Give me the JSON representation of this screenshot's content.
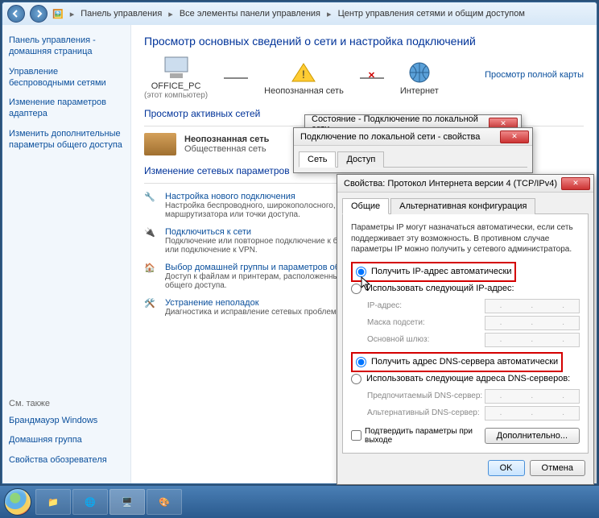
{
  "breadcrumb": [
    "Панель управления",
    "Все элементы панели управления",
    "Центр управления сетями и общим доступом"
  ],
  "sidebar": {
    "items": [
      "Панель управления - домашняя страница",
      "Управление беспроводными сетями",
      "Изменение параметров адаптера",
      "Изменить дополнительные параметры общего доступа"
    ],
    "also_label": "См. также",
    "also": [
      "Брандмауэр Windows",
      "Домашняя группа",
      "Свойства обозревателя"
    ]
  },
  "page": {
    "title": "Просмотр основных сведений о сети и настройка подключений",
    "map_link": "Просмотр полной карты",
    "nodes": {
      "pc": "OFFICE_PC",
      "pc_sub": "(этот компьютер)",
      "unknown": "Неопознанная сеть",
      "internet": "Интернет"
    },
    "active_head": "Просмотр активных сетей",
    "active_name": "Неопознанная сеть",
    "active_type": "Общественная сеть",
    "change_head": "Изменение сетевых параметров",
    "tasks": [
      {
        "link": "Настройка нового подключения",
        "desc": "Настройка беспроводного, широкополосного, модемного, прямого или VPN-подключения или же настройка маршрутизатора или точки доступа."
      },
      {
        "link": "Подключиться к сети",
        "desc": "Подключение или повторное подключение к беспроводному, проводному, модемному сетевому соединению или подключение к VPN."
      },
      {
        "link": "Выбор домашней группы и параметров общего доступа",
        "desc": "Доступ к файлам и принтерам, расположенным на других сетевых компьютерах, или изменение параметров общего доступа."
      },
      {
        "link": "Устранение неполадок",
        "desc": "Диагностика и исправление сетевых проблем или получение сведений об исправлении."
      }
    ]
  },
  "dlg_status": {
    "title": "Состояние - Подключение по локальной сети"
  },
  "dlg_props": {
    "title": "Подключение по локальной сети - свойства",
    "tabs": [
      "Сеть",
      "Доступ"
    ]
  },
  "dlg_ipv4": {
    "title": "Свойства: Протокол Интернета версии 4 (TCP/IPv4)",
    "tabs": [
      "Общие",
      "Альтернативная конфигурация"
    ],
    "desc": "Параметры IP могут назначаться автоматически, если сеть поддерживает эту возможность. В противном случае параметры IP можно получить у сетевого администратора.",
    "radio_ip_auto": "Получить IP-адрес автоматически",
    "radio_ip_manual": "Использовать следующий IP-адрес:",
    "lbl_ip": "IP-адрес:",
    "lbl_mask": "Маска подсети:",
    "lbl_gw": "Основной шлюз:",
    "radio_dns_auto": "Получить адрес DNS-сервера автоматически",
    "radio_dns_manual": "Использовать следующие адреса DNS-серверов:",
    "lbl_dns1": "Предпочитаемый DNS-сервер:",
    "lbl_dns2": "Альтернативный DNS-сервер:",
    "confirm": "Подтвердить параметры при выходе",
    "advanced": "Дополнительно...",
    "ok": "OK",
    "cancel": "Отмена"
  }
}
